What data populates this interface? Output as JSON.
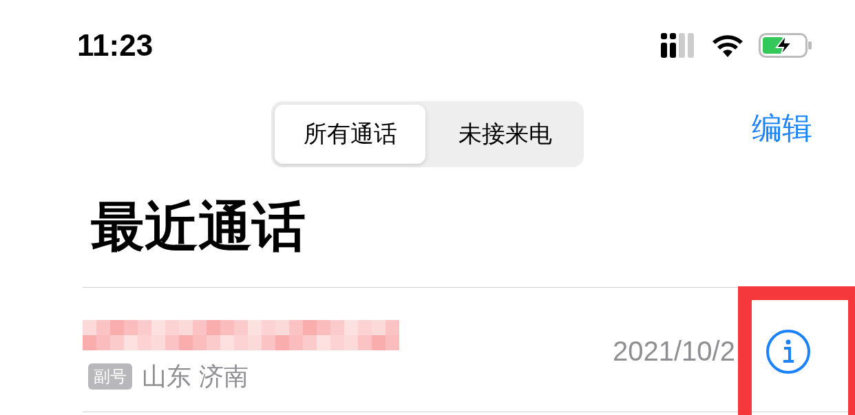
{
  "status_bar": {
    "time": "11:23"
  },
  "segments": [
    {
      "label": "所有通话",
      "selected": true
    },
    {
      "label": "未接来电",
      "selected": false
    }
  ],
  "edit_button": "编辑",
  "title": "最近通话",
  "calls": [
    {
      "tag": "副号",
      "location": "山东 济南",
      "date": "2021/10/2",
      "highlighted": true
    }
  ]
}
